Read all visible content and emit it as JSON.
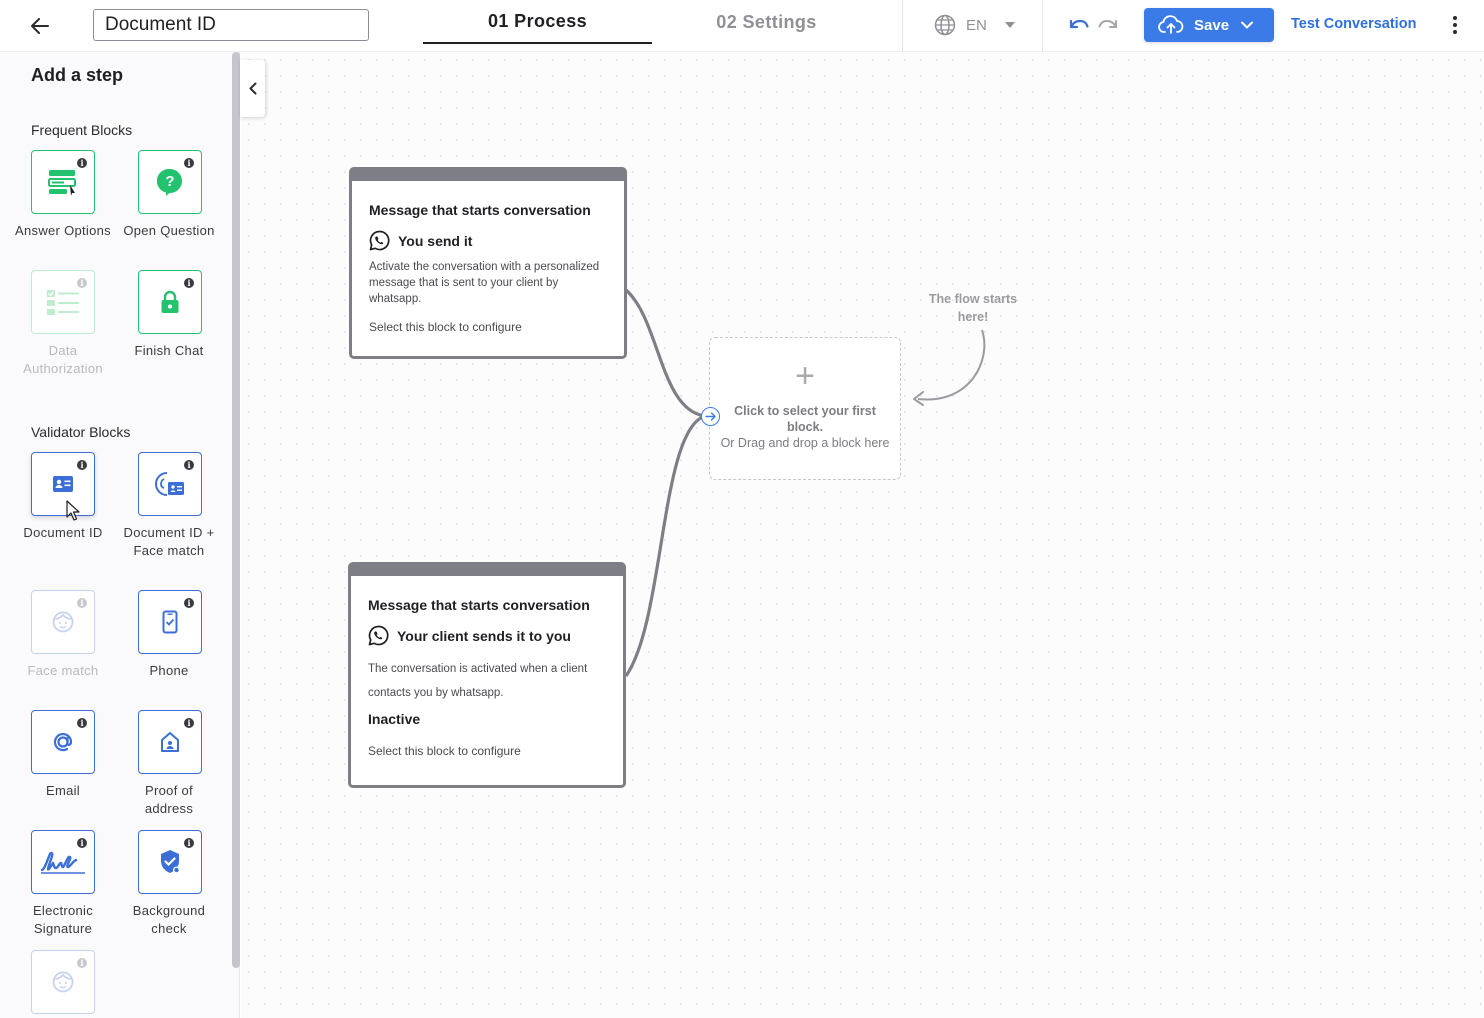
{
  "header": {
    "document_name": "Document ID",
    "tabs": [
      {
        "label": "01 Process",
        "active": true
      },
      {
        "label": "02 Settings",
        "active": false
      }
    ],
    "language": "EN",
    "save_label": "Save",
    "test_label": "Test Conversation"
  },
  "sidebar": {
    "title": "Add a step",
    "frequent_title": "Frequent Blocks",
    "validator_title": "Validator Blocks",
    "frequent": [
      {
        "label": "Answer Options",
        "icon": "answer-options-icon",
        "enabled": true
      },
      {
        "label": "Open Question",
        "icon": "open-question-icon",
        "enabled": true
      },
      {
        "label": "Data Authorization",
        "icon": "data-authorization-icon",
        "enabled": false
      },
      {
        "label": "Finish Chat",
        "icon": "lock-icon",
        "enabled": true
      }
    ],
    "validators": [
      {
        "label": "Document ID",
        "icon": "id-card-icon",
        "enabled": true
      },
      {
        "label": "Document ID + Face match",
        "icon": "face-id-card-icon",
        "enabled": true
      },
      {
        "label": "Face match",
        "icon": "face-icon",
        "enabled": false
      },
      {
        "label": "Phone",
        "icon": "phone-icon",
        "enabled": true
      },
      {
        "label": "Email",
        "icon": "at-sign-icon",
        "enabled": true
      },
      {
        "label": "Proof of address",
        "icon": "home-id-icon",
        "enabled": true
      },
      {
        "label": "Electronic Signature",
        "icon": "signature-icon",
        "enabled": true
      },
      {
        "label": "Background check",
        "icon": "shield-check-icon",
        "enabled": true
      },
      {
        "label": "",
        "icon": "face-icon",
        "enabled": false
      }
    ]
  },
  "canvas": {
    "card1": {
      "title": "Message that starts conversation",
      "subtitle": "You send it",
      "description": "Activate the conversation with a personalized message that is sent to your client by whatsapp.",
      "configure": "Select this block to configure"
    },
    "card2": {
      "title": "Message that starts conversation",
      "subtitle": "Your client sends it to you",
      "description": "The conversation is activated when a client contacts you by whatsapp.",
      "status": "Inactive",
      "configure": "Select this block to configure"
    },
    "dropzone": {
      "plus": "+",
      "main": "Click to select your first block.",
      "sub": "Or Drag and drop a block here"
    },
    "hint": "The flow starts here!"
  },
  "colors": {
    "accent": "#3b7be8",
    "block_green": "#22c26e",
    "block_blue": "#3b6fd6",
    "connector": "#7e7f86"
  }
}
